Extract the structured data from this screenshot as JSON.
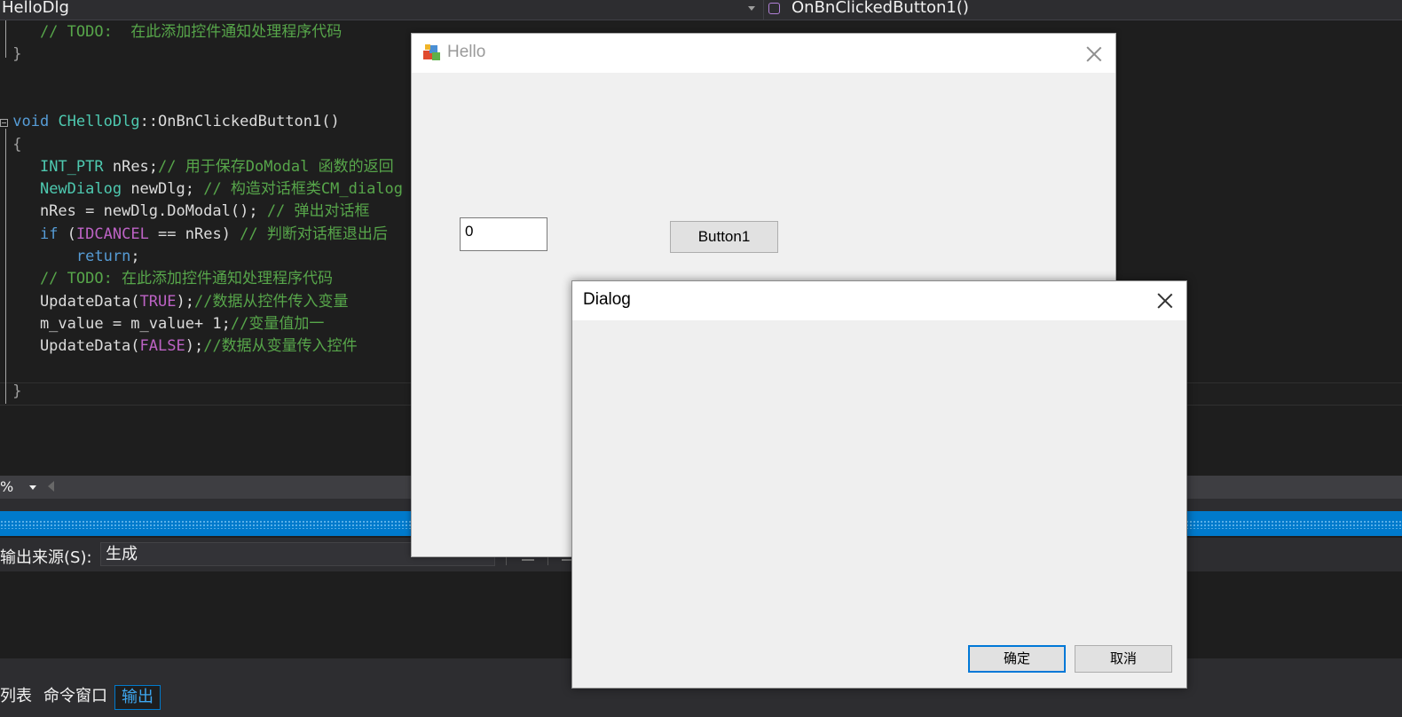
{
  "navbar": {
    "class_dropdown": "HelloDlg",
    "member_dropdown": "OnBnClickedButton1()"
  },
  "editor": {
    "lines": [
      {
        "parts": [
          {
            "t": "    // TODO:  在此添加控件通知处理程序代码",
            "c": "cm"
          }
        ]
      },
      {
        "parts": [
          {
            "t": " }",
            "c": "gr"
          }
        ]
      },
      {
        "parts": []
      },
      {
        "parts": []
      },
      {
        "parts": [
          {
            "t": " void",
            "c": "kw"
          },
          {
            "t": " ",
            "c": ""
          },
          {
            "t": "CHelloDlg",
            "c": "ty"
          },
          {
            "t": "::OnBnClickedButton1()",
            "c": ""
          }
        ]
      },
      {
        "parts": [
          {
            "t": " {",
            "c": "gr"
          }
        ]
      },
      {
        "parts": [
          {
            "t": "    ",
            "c": ""
          },
          {
            "t": "INT_PTR",
            "c": "ty"
          },
          {
            "t": " nRes;",
            "c": ""
          },
          {
            "t": "// 用于保存DoModal 函数的返回",
            "c": "cm"
          }
        ]
      },
      {
        "parts": [
          {
            "t": "    ",
            "c": ""
          },
          {
            "t": "NewDialog",
            "c": "ty"
          },
          {
            "t": " newDlg; ",
            "c": ""
          },
          {
            "t": "// 构造对话框类CM_dialog",
            "c": "cm"
          }
        ]
      },
      {
        "parts": [
          {
            "t": "    nRes = newDlg.DoModal(); ",
            "c": ""
          },
          {
            "t": "// 弹出对话框",
            "c": "cm"
          }
        ]
      },
      {
        "parts": [
          {
            "t": "    ",
            "c": ""
          },
          {
            "t": "if",
            "c": "kw"
          },
          {
            "t": " (",
            "c": ""
          },
          {
            "t": "IDCANCEL",
            "c": "mac"
          },
          {
            "t": " == nRes) ",
            "c": ""
          },
          {
            "t": "// 判断对话框退出后",
            "c": "cm"
          }
        ]
      },
      {
        "parts": [
          {
            "t": "        ",
            "c": ""
          },
          {
            "t": "return",
            "c": "kw"
          },
          {
            "t": ";",
            "c": ""
          }
        ]
      },
      {
        "parts": [
          {
            "t": "    // TODO: 在此添加控件通知处理程序代码",
            "c": "cm"
          }
        ]
      },
      {
        "parts": [
          {
            "t": "    UpdateData(",
            "c": ""
          },
          {
            "t": "TRUE",
            "c": "mac"
          },
          {
            "t": ");",
            "c": ""
          },
          {
            "t": "//数据从控件传入变量",
            "c": "cm"
          }
        ]
      },
      {
        "parts": [
          {
            "t": "    m_value = m_value+ 1;",
            "c": ""
          },
          {
            "t": "//变量值加一",
            "c": "cm"
          }
        ]
      },
      {
        "parts": [
          {
            "t": "    UpdateData(",
            "c": ""
          },
          {
            "t": "FALSE",
            "c": "mac"
          },
          {
            "t": ");",
            "c": ""
          },
          {
            "t": "//数据从变量传入控件",
            "c": "cm"
          }
        ]
      },
      {
        "parts": []
      },
      {
        "parts": [
          {
            "t": " }",
            "c": "gr"
          }
        ]
      }
    ]
  },
  "zoom": {
    "value": "%"
  },
  "output": {
    "source_label": "输出来源(S):",
    "source_value": "生成"
  },
  "bottom_tabs": [
    {
      "label": "列表"
    },
    {
      "label": "命令窗口"
    },
    {
      "label": "输出"
    }
  ],
  "hello_dialog": {
    "title": "Hello",
    "edit_value": "0",
    "button_label": "Button1"
  },
  "dialog": {
    "title": "Dialog",
    "ok_label": "确定",
    "cancel_label": "取消"
  },
  "colors": {
    "accent": "#007acc",
    "editor_bg": "#1e1e1e",
    "comment": "#57a64a",
    "keyword": "#569cd6",
    "type": "#4ec9b0",
    "macro": "#bd63c5"
  }
}
